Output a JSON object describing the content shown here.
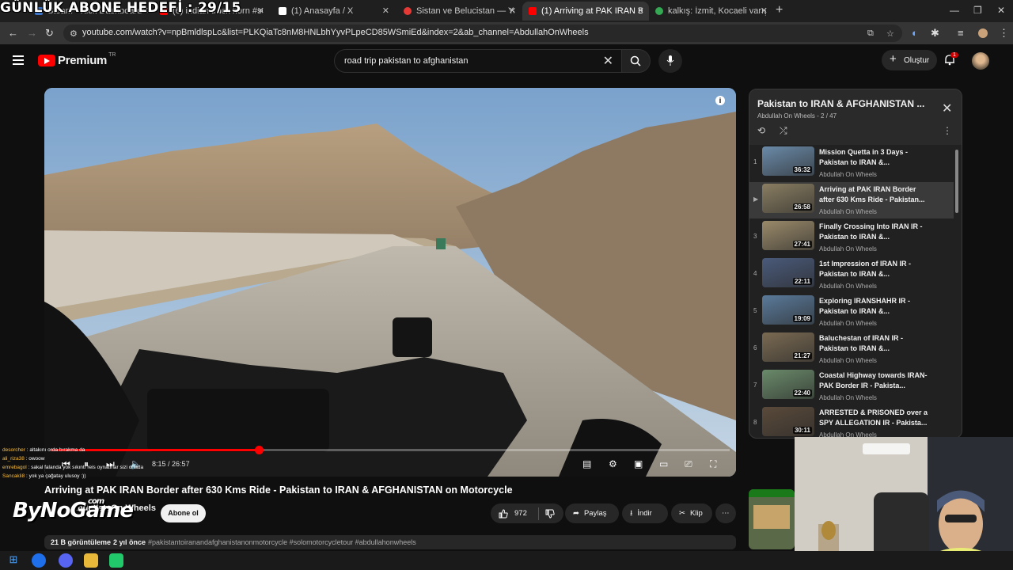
{
  "overlay_banner": "GÜNLÜK ABONE HEDEFİ : 29/15",
  "tabs": [
    {
      "label": "Steam - Kick Dashboard",
      "color": "#3a73c8"
    },
    {
      "label": "(6) indian truck horn #sorts",
      "color": "#ff0000"
    },
    {
      "label": "(1) Anasayfa / X",
      "color": "#ffffff"
    },
    {
      "label": "Sistan ve Belucistan — Yandex",
      "color": "#e53935"
    },
    {
      "label": "(1) Arriving at PAK IRAN Bo",
      "color": "#ff0000"
    },
    {
      "label": "kalkış: İzmit, Kocaeli varış: Mos",
      "color": "#34a853"
    }
  ],
  "address_bar": {
    "url": "youtube.com/watch?v=npBmldlspLc&list=PLKQiaTc8nM8HNLbhYyvPLpeCD85WSmiEd&index=2&ab_channel=AbdullahOnWheels"
  },
  "youtube": {
    "brand": "Premium",
    "country": "TR",
    "search_query": "road trip pakistan to afghanistan",
    "create_label": "Oluştur",
    "notifications": "1"
  },
  "player": {
    "current_time": "8:15",
    "duration": "26:57",
    "progress": 0.306
  },
  "chat": [
    {
      "name": "desorcher",
      "msg": "altakını orda bırakma da"
    },
    {
      "name": "ali_riza38",
      "msg": "owoow"
    },
    {
      "name": "emrebagol",
      "msg": "sakal falanda yok sıkıntı reis oynatırlar sizi ortada"
    },
    {
      "name": "Sancakli8",
      "msg": "yok ya çağatay ulusoy :))"
    }
  ],
  "video": {
    "title": "Arriving at PAK IRAN Border after 630 Kms Ride - Pakistan to IRAN & AFGHANISTAN on Motorcycle",
    "channel": "Abdullah On Wheels",
    "subscribe_label": "Abone ol",
    "likes": "972",
    "share_label": "Paylaş",
    "download_label": "İndir",
    "clip_label": "Klip",
    "views": "21 B görüntüleme",
    "age": "2 yıl önce",
    "tags": "#pakistantoiranandafghanistanonmotorcycle #solomotorcycletour #abdullahonwheels"
  },
  "watermark": {
    "text": "ByNoGame",
    "suffix": "com"
  },
  "playlist": {
    "title": "Pakistan to IRAN & AFGHANISTAN ...",
    "owner": "Abdullah On Wheels",
    "position": "2 / 47",
    "items": [
      {
        "num": "1",
        "title": "Mission Quetta in 3 Days - Pakistan to IRAN &...",
        "channel": "Abdullah On Wheels",
        "duration": "36:32",
        "thumb": "#6a8aa8"
      },
      {
        "num": "▶",
        "title": "Arriving at PAK IRAN Border after 630 Kms Ride - Pakistan...",
        "channel": "Abdullah On Wheels",
        "duration": "26:58",
        "thumb": "#8a7e62"
      },
      {
        "num": "3",
        "title": "Finally Crossing Into IRAN IR - Pakistan to IRAN &...",
        "channel": "Abdullah On Wheels",
        "duration": "27:41",
        "thumb": "#9a8a6a"
      },
      {
        "num": "4",
        "title": "1st Impression of IRAN IR - Pakistan to IRAN &...",
        "channel": "Abdullah On Wheels",
        "duration": "22:11",
        "thumb": "#4a5a7a"
      },
      {
        "num": "5",
        "title": "Exploring IRANSHAHR IR - Pakistan to IRAN &...",
        "channel": "Abdullah On Wheels",
        "duration": "19:09",
        "thumb": "#5a7a9a"
      },
      {
        "num": "6",
        "title": "Baluchestan of IRAN IR - Pakistan to IRAN &...",
        "channel": "Abdullah On Wheels",
        "duration": "21:27",
        "thumb": "#7a6a52"
      },
      {
        "num": "7",
        "title": "Coastal Highway towards IRAN-PAK Border IR - Pakista...",
        "channel": "Abdullah On Wheels",
        "duration": "22:40",
        "thumb": "#6a8a6a"
      },
      {
        "num": "8",
        "title": "ARRESTED & PRISONED over a SPY ALLEGATION IR - Pakista...",
        "channel": "Abdullah On Wheels",
        "duration": "30:11",
        "thumb": "#5a4a3a"
      },
      {
        "num": "9",
        "title": "",
        "channel": "",
        "duration": "",
        "thumb": "#6a7a5a"
      }
    ]
  },
  "colors": {
    "accent": "#ff0000",
    "bg": "#0f0f0f"
  }
}
